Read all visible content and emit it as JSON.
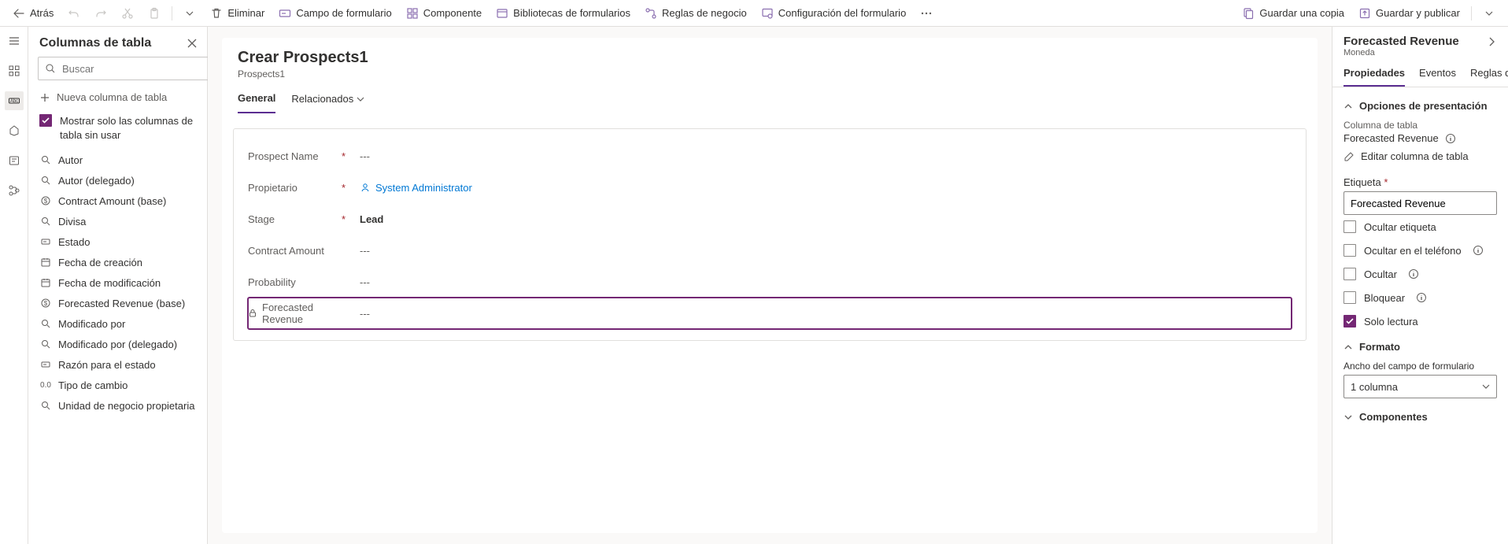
{
  "toolbar": {
    "back": "Atrás",
    "delete": "Eliminar",
    "formField": "Campo de formulario",
    "component": "Componente",
    "libraries": "Bibliotecas de formularios",
    "rules": "Reglas de negocio",
    "settings": "Configuración del formulario",
    "saveCopy": "Guardar una copia",
    "savePublish": "Guardar y publicar"
  },
  "columnsPanel": {
    "title": "Columnas de tabla",
    "searchPlaceholder": "Buscar",
    "newColumn": "Nueva columna de tabla",
    "onlyUnused": "Mostrar solo las columnas de tabla sin usar",
    "items": [
      {
        "icon": "lookup",
        "label": "Autor"
      },
      {
        "icon": "lookup",
        "label": "Autor (delegado)"
      },
      {
        "icon": "currency",
        "label": "Contract Amount (base)"
      },
      {
        "icon": "lookup",
        "label": "Divisa"
      },
      {
        "icon": "option",
        "label": "Estado"
      },
      {
        "icon": "date",
        "label": "Fecha de creación"
      },
      {
        "icon": "date",
        "label": "Fecha de modificación"
      },
      {
        "icon": "currency",
        "label": "Forecasted Revenue (base)"
      },
      {
        "icon": "lookup",
        "label": "Modificado por"
      },
      {
        "icon": "lookup",
        "label": "Modificado por (delegado)"
      },
      {
        "icon": "option",
        "label": "Razón para el estado"
      },
      {
        "icon": "decimal",
        "label": "Tipo de cambio"
      },
      {
        "icon": "lookup",
        "label": "Unidad de negocio propietaria"
      }
    ]
  },
  "form": {
    "title": "Crear Prospects1",
    "entity": "Prospects1",
    "tabs": {
      "general": "General",
      "related": "Relacionados"
    },
    "fields": [
      {
        "label": "Prospect Name",
        "required": true,
        "value": "---",
        "type": "text"
      },
      {
        "label": "Propietario",
        "required": true,
        "value": "System Administrator",
        "type": "user"
      },
      {
        "label": "Stage",
        "required": true,
        "value": "Lead",
        "type": "bold"
      },
      {
        "label": "Contract Amount",
        "required": false,
        "value": "---",
        "type": "text"
      },
      {
        "label": "Probability",
        "required": false,
        "value": "---",
        "type": "text"
      },
      {
        "label": "Forecasted Revenue",
        "required": false,
        "value": "---",
        "type": "locked",
        "selected": true
      }
    ]
  },
  "properties": {
    "title": "Forecasted Revenue",
    "subtitle": "Moneda",
    "tabs": {
      "props": "Propiedades",
      "events": "Eventos",
      "rules": "Reglas de ne"
    },
    "displayOptions": "Opciones de presentación",
    "tableColumn": "Columna de tabla",
    "columnName": "Forecasted Revenue",
    "editColumn": "Editar columna de tabla",
    "labelField": "Etiqueta",
    "labelValue": "Forecasted Revenue",
    "hideLabel": "Ocultar etiqueta",
    "hidePhone": "Ocultar en el teléfono",
    "hide": "Ocultar",
    "lock": "Bloquear",
    "readonly": "Solo lectura",
    "format": "Formato",
    "widthLabel": "Ancho del campo de formulario",
    "widthValue": "1 columna",
    "components": "Componentes"
  }
}
